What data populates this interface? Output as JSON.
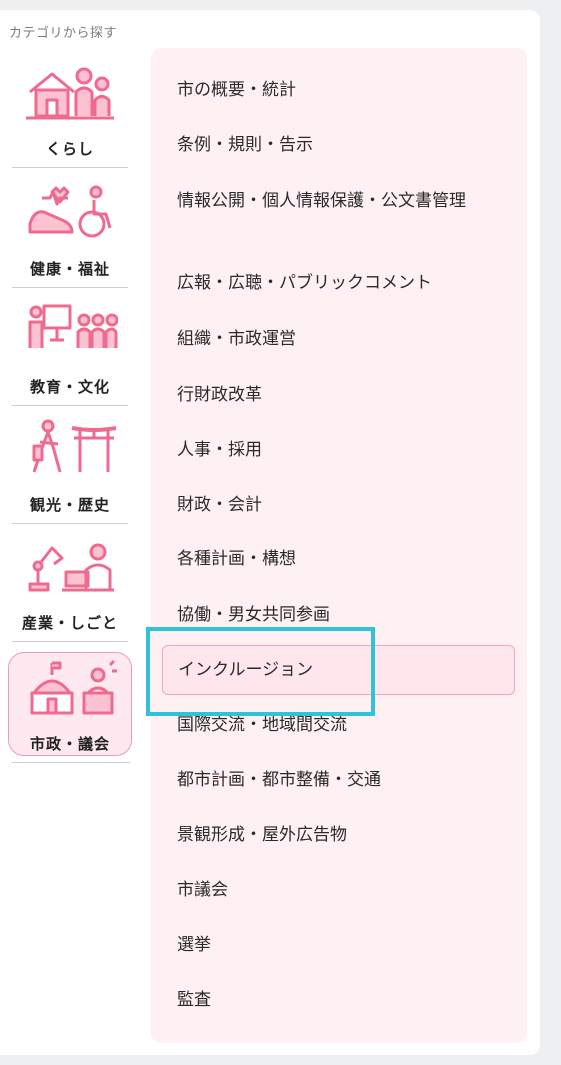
{
  "header": {
    "title": "カテゴリから探す"
  },
  "categories": [
    {
      "label": "くらし",
      "icon": "family-house-icon"
    },
    {
      "label": "健康・福祉",
      "icon": "health-welfare-icon"
    },
    {
      "label": "教育・文化",
      "icon": "education-icon"
    },
    {
      "label": "観光・歴史",
      "icon": "tourism-torii-icon"
    },
    {
      "label": "産業・しごと",
      "icon": "industry-work-icon"
    },
    {
      "label": "市政・議会",
      "icon": "city-hall-icon",
      "active": true
    }
  ],
  "subcategories": [
    "市の概要・統計",
    "条例・規則・告示",
    "情報公開・個人情報保護・公文書管理",
    "広報・広聴・パブリックコメント",
    "組織・市政運営",
    "行財政改革",
    "人事・採用",
    "財政・会計",
    "各種計画・構想",
    "協働・男女共同参画",
    "インクルージョン",
    "国際交流・地域間交流",
    "都市計画・都市整備・交通",
    "景観形成・屋外広告物",
    "市議会",
    "選挙",
    "監査"
  ],
  "selected_subcategory": "インクルージョン",
  "colors": {
    "accent": "#f06a8f",
    "highlight": "#2ec3d7",
    "panel_bg": "#fff0f3"
  }
}
